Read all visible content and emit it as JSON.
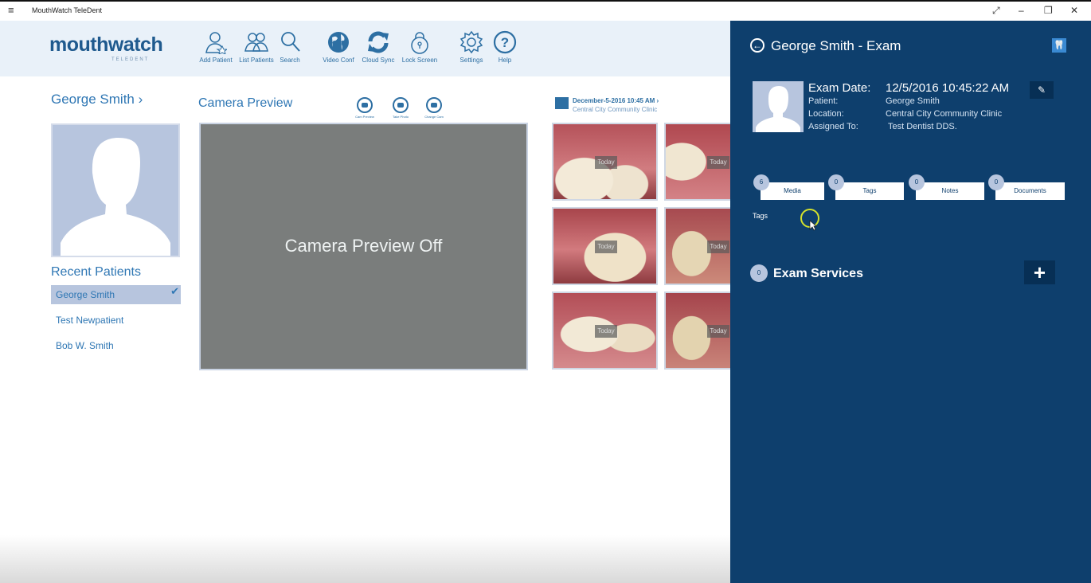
{
  "titlebar": {
    "app_title": "MouthWatch TeleDent",
    "menu_glyph": "≡",
    "controls": [
      "⤢",
      "–",
      "❐",
      "✕"
    ]
  },
  "header": {
    "logo_text": "mouthwatch",
    "logo_sub": "TELEDENT",
    "tools": [
      {
        "label": "Add Patient",
        "icon": "add-patient-icon"
      },
      {
        "label": "List Patients",
        "icon": "list-patients-icon"
      },
      {
        "label": "Search",
        "icon": "search-icon"
      },
      {
        "label": "Video Conf",
        "icon": "globe-icon"
      },
      {
        "label": "Cloud Sync",
        "icon": "sync-icon"
      },
      {
        "label": "Lock Screen",
        "icon": "lock-icon"
      },
      {
        "label": "Settings",
        "icon": "gear-icon"
      },
      {
        "label": "Help",
        "icon": "help-icon"
      }
    ]
  },
  "left": {
    "patient_name": "George  Smith  ›",
    "recent_title": "Recent Patients",
    "recent_patients": [
      "George  Smith",
      "Test  Newpatient",
      "Bob W. Smith"
    ],
    "check_glyph": "✔"
  },
  "camera": {
    "title": "Camera Preview",
    "off_text": "Camera Preview Off",
    "tools": [
      "Cam Preview",
      "Take Photo",
      "Change Cam"
    ]
  },
  "gallery": {
    "date": "December-5-2016  10:45 AM ›",
    "clinic": "Central City Community Clinic",
    "thumb_label": "Today"
  },
  "panel": {
    "title": "George  Smith - Exam",
    "back_glyph": "←",
    "tooth_glyph": "🦷",
    "exam_date_label": "Exam Date:",
    "exam_date_value": "12/5/2016 10:45:22 AM",
    "patient_label": "Patient:",
    "patient_value": "George  Smith",
    "location_label": "Location:",
    "location_value": "Central City Community Clinic",
    "assigned_label": "Assigned To:",
    "assigned_value": "Test Dentist DDS.",
    "edit_glyph": "✎",
    "tabs": [
      {
        "label": "Media",
        "count": "6"
      },
      {
        "label": "Tags",
        "count": "0"
      },
      {
        "label": "Notes",
        "count": "0"
      },
      {
        "label": "Documents",
        "count": "0"
      }
    ],
    "tags_label": "Tags",
    "services_count": "0",
    "services_title": "Exam Services",
    "add_glyph": "+"
  }
}
